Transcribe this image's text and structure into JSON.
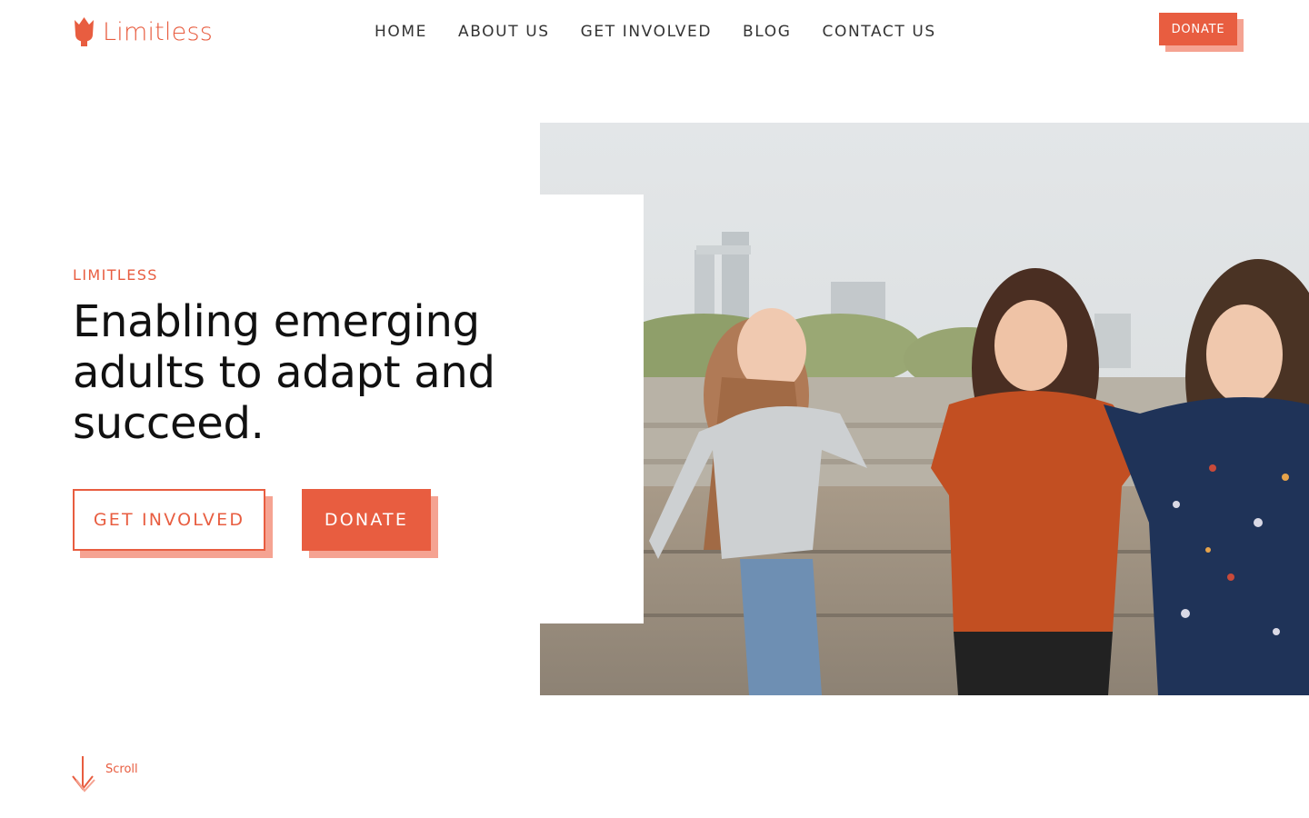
{
  "brand": {
    "name": "Limitless",
    "accent": "#e85d40",
    "accent_light": "#f5a392"
  },
  "nav": {
    "items": [
      {
        "label": "HOME"
      },
      {
        "label": "ABOUT US"
      },
      {
        "label": "GET INVOLVED"
      },
      {
        "label": "BLOG"
      },
      {
        "label": "CONTACT US"
      }
    ],
    "donate_label": "DONATE"
  },
  "hero": {
    "eyebrow": "LIMITLESS",
    "headline": "Enabling emerging adults to adapt and succeed.",
    "primary_cta": "GET INVOLVED",
    "secondary_cta": "DONATE",
    "image_icon": "photo-three-women-laughing"
  },
  "scroll": {
    "label": "Scroll",
    "icon": "arrow-down-icon"
  }
}
